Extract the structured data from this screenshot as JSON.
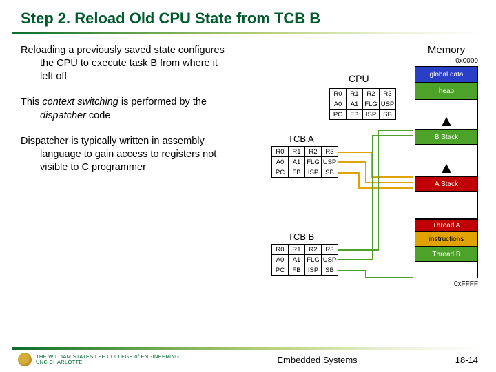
{
  "title": "Step 2. Reload Old CPU State from TCB B",
  "paragraphs": {
    "p1": "Reloading a previously saved state configures the CPU to execute task B from where it left off",
    "p2a": "This ",
    "p2b": "context switching",
    "p2c": " is performed by the ",
    "p2d": "dispatcher",
    "p2e": " code",
    "p3": "Dispatcher is typically written in assembly language to gain access to registers not visible to C programmer"
  },
  "cpu": {
    "label": "CPU",
    "rows": [
      [
        "R0",
        "R1",
        "R2",
        "R3"
      ],
      [
        "A0",
        "A1",
        "FLG",
        "USP"
      ],
      [
        "PC",
        "FB",
        "ISP",
        "SB"
      ]
    ]
  },
  "tcba": {
    "label": "TCB A",
    "rows": [
      [
        "R0",
        "R1",
        "R2",
        "R3"
      ],
      [
        "A0",
        "A1",
        "FLG",
        "USP"
      ],
      [
        "PC",
        "FB",
        "ISP",
        "SB"
      ]
    ]
  },
  "tcbb": {
    "label": "TCB B",
    "rows": [
      [
        "R0",
        "R1",
        "R2",
        "R3"
      ],
      [
        "A0",
        "A1",
        "FLG",
        "USP"
      ],
      [
        "PC",
        "FB",
        "ISP",
        "SB"
      ]
    ]
  },
  "memory": {
    "title": "Memory",
    "addr_top": "0x0000",
    "addr_bot": "0xFFFF",
    "segs": {
      "global": "global data",
      "heap": "heap",
      "bstack": "B Stack",
      "astack": "A Stack",
      "tha": "Thread A",
      "instr": "instructions",
      "thb": "Thread B"
    }
  },
  "footer": {
    "logo_line1": "THE WILLIAM STATES LEE COLLEGE of ENGINEERING",
    "logo_line2": "UNC CHARLOTTE",
    "center": "Embedded Systems",
    "page": "18-14"
  }
}
